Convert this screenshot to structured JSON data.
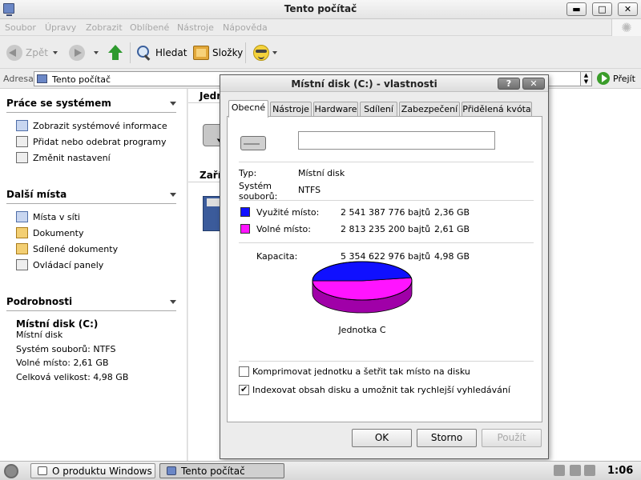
{
  "window": {
    "title": "Tento počítač",
    "minimize": "▬",
    "maximize": "□",
    "close": "✕"
  },
  "menubar": [
    "Soubor",
    "Úpravy",
    "Zobrazit",
    "Oblíbené",
    "Nástroje",
    "Nápověda"
  ],
  "toolbar": {
    "back": "Zpět",
    "search": "Hledat",
    "folders": "Složky"
  },
  "address": {
    "label": "Adresa",
    "value": "Tento počítač",
    "go": "Přejít"
  },
  "taskpane": {
    "system": {
      "title": "Práce se systémem",
      "items": [
        "Zobrazit systémové informace",
        "Přidat nebo odebrat programy",
        "Změnit nastavení"
      ]
    },
    "places": {
      "title": "Další místa",
      "items": [
        "Místa v síti",
        "Dokumenty",
        "Sdílené dokumenty",
        "Ovládací panely"
      ]
    },
    "details": {
      "title": "Podrobnosti",
      "name": "Místní disk (C:)",
      "type": "Místní disk",
      "fs": "Systém souborů: NTFS",
      "free": "Volné místo: 2,61 GB",
      "total": "Celková velikost: 4,98 GB"
    }
  },
  "content": {
    "group1": "Jedn",
    "group2": "Zaříz"
  },
  "dialog": {
    "title": "Místní disk (C:) - vlastnosti",
    "help": "?",
    "close": "✕",
    "tabs": [
      "Obecné",
      "Nástroje",
      "Hardware",
      "Sdílení",
      "Zabezpečení",
      "Přidělená kvóta"
    ],
    "name_value": "",
    "type_label": "Typ:",
    "type_value": "Místní disk",
    "fs_label": "Systém souborů:",
    "fs_value": "NTFS",
    "used_label": "Využité místo:",
    "used_bytes": "2 541 387 776 bajtů",
    "used_gb": "2,36 GB",
    "free_label": "Volné místo:",
    "free_bytes": "2 813 235 200 bajtů",
    "free_gb": "2,61 GB",
    "cap_label": "Kapacita:",
    "cap_bytes": "5 354 622 976 bajtů",
    "cap_gb": "4,98 GB",
    "drive_label": "Jednotka C",
    "compress": "Komprimovat jednotku a šetřit tak místo na disku",
    "compress_checked": false,
    "index": "Indexovat obsah disku a umožnit tak rychlejší vyhledávání",
    "index_checked": true,
    "ok": "OK",
    "cancel": "Storno",
    "apply": "Použít",
    "colors": {
      "used": "#1010ff",
      "free": "#ff14ff"
    },
    "used_fraction": 0.4746
  },
  "taskbar": {
    "items": [
      "O produktu Windows",
      "Tento počítač"
    ],
    "clock": "1:06"
  }
}
